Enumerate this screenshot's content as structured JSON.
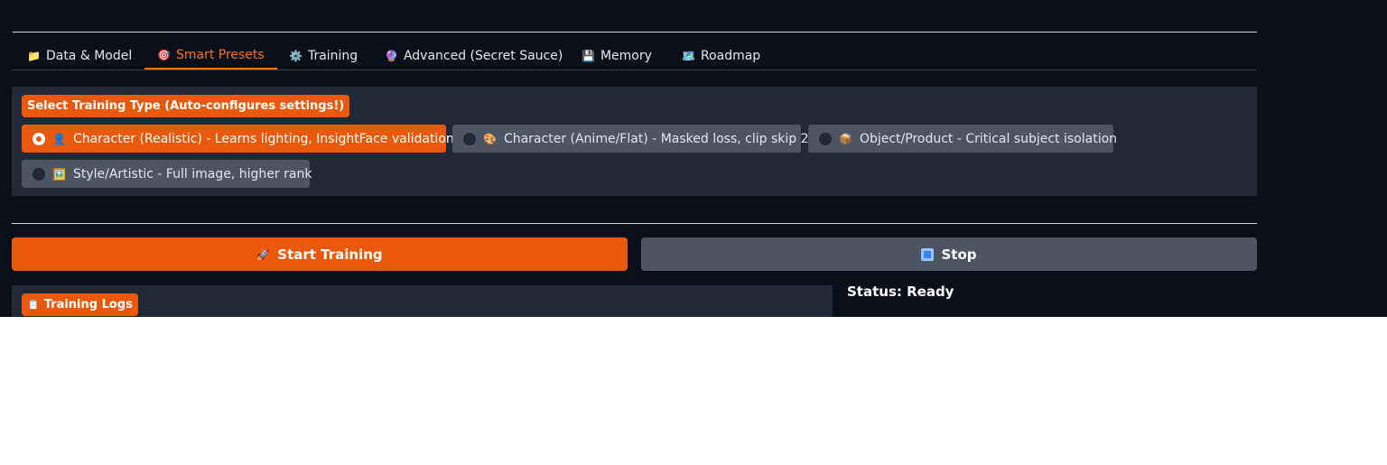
{
  "tabs": [
    {
      "icon": "📁",
      "label": "Data & Model"
    },
    {
      "icon": "🎯",
      "label": "Smart Presets"
    },
    {
      "icon": "⚙️",
      "label": "Training"
    },
    {
      "icon": "🔮",
      "label": "Advanced (Secret Sauce)"
    },
    {
      "icon": "💾",
      "label": "Memory"
    },
    {
      "icon": "🗺️",
      "label": "Roadmap"
    }
  ],
  "active_tab": "Smart Presets",
  "presets": {
    "label": "Select Training Type (Auto-configures settings!)",
    "options": [
      {
        "icon": "👤",
        "label": "Character (Realistic) - Learns lighting, InsightFace validation",
        "selected": true
      },
      {
        "icon": "🎨",
        "label": "Character (Anime/Flat) - Masked loss, clip skip 2",
        "selected": false
      },
      {
        "icon": "📦",
        "label": "Object/Product - Critical subject isolation",
        "selected": false
      },
      {
        "icon": "🖼️",
        "label": "Style/Artistic - Full image, higher rank",
        "selected": false
      }
    ]
  },
  "actions": {
    "start_icon": "🚀",
    "start_label": "Start Training",
    "stop_label": "Stop"
  },
  "logs": {
    "icon": "📋",
    "label": "Training Logs"
  },
  "status": "Status: Ready",
  "colors": {
    "accent": "#ea580c",
    "background": "#0b0f19",
    "panel": "#1f2937",
    "secondary_button": "#4b5563"
  }
}
